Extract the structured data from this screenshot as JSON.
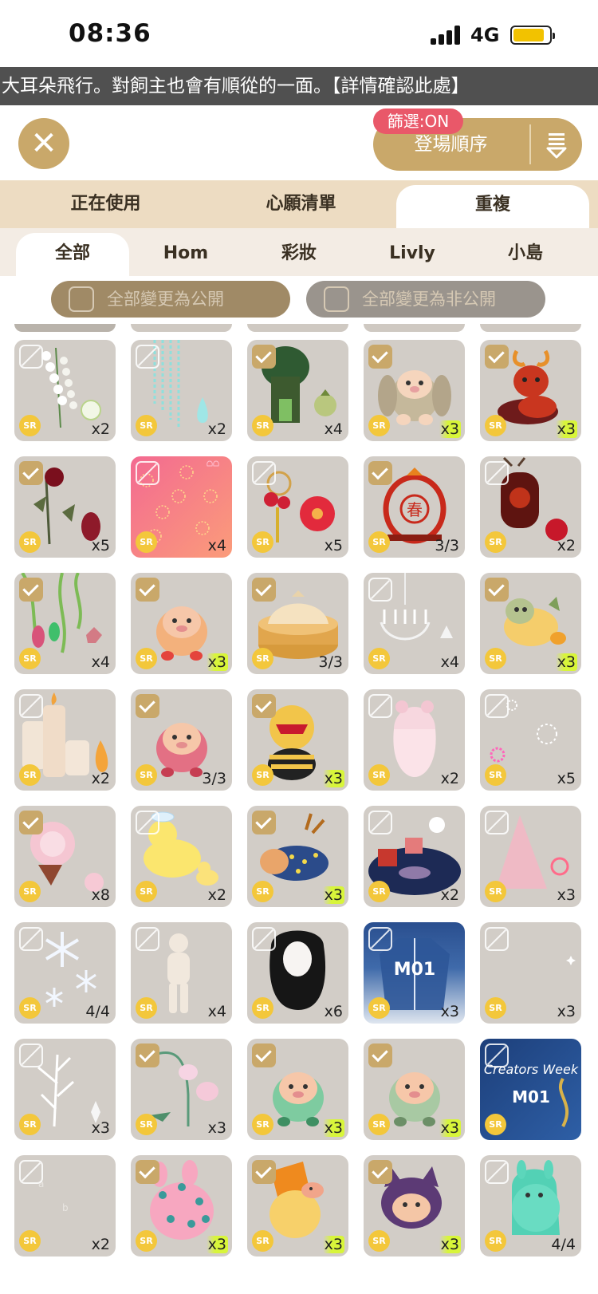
{
  "status": {
    "time": "08:36",
    "network": "4G"
  },
  "ticker": "大耳朵飛行。對飼主也會有順從的一面。【詳情確認此處】",
  "top": {
    "close_icon": "close-icon",
    "sort_label": "登場順序",
    "filter_badge": "篩選:ON",
    "accent": "#c9a86a"
  },
  "tabs_primary": [
    {
      "label": "正在使用",
      "active": false
    },
    {
      "label": "心願清單",
      "active": false
    },
    {
      "label": "重複",
      "active": true
    }
  ],
  "tabs_secondary": [
    {
      "label": "全部",
      "active": true
    },
    {
      "label": "Hom",
      "active": false
    },
    {
      "label": "彩妝",
      "active": false
    },
    {
      "label": "Livly",
      "active": false
    },
    {
      "label": "小島",
      "active": false
    }
  ],
  "actions": {
    "make_public": "全部變更為公開",
    "make_private": "全部變更為非公開"
  },
  "rarity": "SR",
  "items": [
    {
      "checked": false,
      "count": "x2",
      "hl": false,
      "icon": "white-flower-icon",
      "bg": "plain"
    },
    {
      "checked": false,
      "count": "x2",
      "hl": false,
      "icon": "water-drop-icon",
      "bg": "plain"
    },
    {
      "checked": true,
      "count": "x4",
      "hl": false,
      "icon": "tree-house-icon",
      "bg": "plain"
    },
    {
      "checked": true,
      "count": "x3",
      "hl": true,
      "icon": "bunny-livly-icon",
      "bg": "plain"
    },
    {
      "checked": true,
      "count": "x3",
      "hl": true,
      "icon": "deer-livly-icon",
      "bg": "plain"
    },
    {
      "checked": true,
      "count": "x5",
      "hl": false,
      "icon": "rose-icon",
      "bg": "plain"
    },
    {
      "checked": false,
      "count": "x4",
      "hl": false,
      "icon": "pink-sparkle-wallpaper-icon",
      "bg": "pink"
    },
    {
      "checked": false,
      "count": "x5",
      "hl": false,
      "icon": "red-flower-ornament-icon",
      "bg": "plain"
    },
    {
      "checked": true,
      "count": "3/3",
      "hl": false,
      "icon": "spring-lantern-icon",
      "bg": "plain"
    },
    {
      "checked": false,
      "count": "x2",
      "hl": false,
      "icon": "apple-icon",
      "bg": "plain"
    },
    {
      "checked": true,
      "count": "x4",
      "hl": false,
      "icon": "jungle-plant-icon",
      "bg": "plain"
    },
    {
      "checked": true,
      "count": "x3",
      "hl": true,
      "icon": "pig-livly-icon",
      "bg": "plain"
    },
    {
      "checked": true,
      "count": "3/3",
      "hl": false,
      "icon": "dumpling-steamer-icon",
      "bg": "plain"
    },
    {
      "checked": false,
      "count": "x4",
      "hl": false,
      "icon": "chandelier-icon",
      "bg": "plain"
    },
    {
      "checked": true,
      "count": "x3",
      "hl": true,
      "icon": "sloth-livly-icon",
      "bg": "plain"
    },
    {
      "checked": false,
      "count": "x2",
      "hl": false,
      "icon": "candle-icon",
      "bg": "plain"
    },
    {
      "checked": true,
      "count": "3/3",
      "hl": false,
      "icon": "pink-robot-livly-icon",
      "bg": "plain"
    },
    {
      "checked": true,
      "count": "x3",
      "hl": true,
      "icon": "bee-livly-icon",
      "bg": "plain"
    },
    {
      "checked": false,
      "count": "x2",
      "hl": false,
      "icon": "ghost-girl-icon",
      "bg": "plain"
    },
    {
      "checked": false,
      "count": "x5",
      "hl": false,
      "icon": "sparkle-ring-icon",
      "bg": "plain"
    },
    {
      "checked": true,
      "count": "x8",
      "hl": false,
      "icon": "peony-icon",
      "bg": "plain"
    },
    {
      "checked": false,
      "count": "x2",
      "hl": false,
      "icon": "rubber-duck-icon",
      "bg": "plain"
    },
    {
      "checked": true,
      "count": "x3",
      "hl": true,
      "icon": "reindeer-livly-icon",
      "bg": "plain"
    },
    {
      "checked": false,
      "count": "x2",
      "hl": false,
      "icon": "gift-rug-icon",
      "bg": "plain"
    },
    {
      "checked": false,
      "count": "x3",
      "hl": false,
      "icon": "christmas-tree-icon",
      "bg": "plain"
    },
    {
      "checked": false,
      "count": "4/4",
      "hl": false,
      "icon": "snowflake-icon",
      "bg": "plain"
    },
    {
      "checked": false,
      "count": "x4",
      "hl": false,
      "icon": "mannequin-icon",
      "bg": "plain"
    },
    {
      "checked": false,
      "count": "x6",
      "hl": false,
      "icon": "black-hair-icon",
      "bg": "plain"
    },
    {
      "checked": false,
      "count": "x3",
      "hl": false,
      "icon": "m01-jacket-icon",
      "bg": "blue"
    },
    {
      "checked": false,
      "count": "x3",
      "hl": false,
      "icon": "sparkle-icon",
      "bg": "plain"
    },
    {
      "checked": false,
      "count": "x3",
      "hl": false,
      "icon": "crystal-leaf-icon",
      "bg": "plain"
    },
    {
      "checked": true,
      "count": "x3",
      "hl": false,
      "icon": "bellflower-icon",
      "bg": "plain"
    },
    {
      "checked": true,
      "count": "x3",
      "hl": true,
      "icon": "green-hood-livly-icon",
      "bg": "plain"
    },
    {
      "checked": true,
      "count": "x3",
      "hl": true,
      "icon": "green-elf-livly-icon",
      "bg": "plain"
    },
    {
      "checked": false,
      "count": "",
      "hl": false,
      "icon": "creators-week-wallpaper-icon",
      "bg": "navy",
      "caption": "Creators Week",
      "sub": "M01"
    },
    {
      "checked": false,
      "count": "x2",
      "hl": false,
      "icon": "faint-letters-icon",
      "bg": "plain"
    },
    {
      "checked": true,
      "count": "x3",
      "hl": true,
      "icon": "pink-bunny-livly-icon",
      "bg": "plain"
    },
    {
      "checked": true,
      "count": "x3",
      "hl": true,
      "icon": "orange-hood-livly-icon",
      "bg": "plain"
    },
    {
      "checked": true,
      "count": "x3",
      "hl": true,
      "icon": "purple-cat-livly-icon",
      "bg": "plain"
    },
    {
      "checked": false,
      "count": "4/4",
      "hl": false,
      "icon": "teal-ghost-livly-icon",
      "bg": "plain"
    }
  ],
  "m01_label": "M01"
}
